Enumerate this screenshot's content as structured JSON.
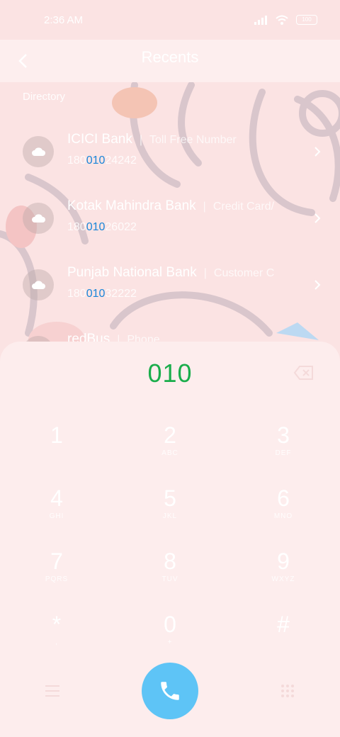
{
  "status": {
    "time": "2:36 AM",
    "battery": "100"
  },
  "header": {
    "title": "Recents"
  },
  "directory": {
    "label": "Directory",
    "items": [
      {
        "name": "ICICI Bank",
        "tag": "Toll Free Number",
        "number_pre": "180",
        "number_match": "010",
        "number_post": "24242"
      },
      {
        "name": "Kotak Mahindra Bank",
        "tag": "Credit Card/",
        "number_pre": "180",
        "number_match": "010",
        "number_post": "26022"
      },
      {
        "name": "Punjab National Bank",
        "tag": "Customer C",
        "number_pre": "180",
        "number_match": "010",
        "number_post": "32222"
      },
      {
        "name": "redBus",
        "tag": "Phone"
      }
    ]
  },
  "dialpad": {
    "input": "010",
    "keys": [
      {
        "digit": "1",
        "letters": ""
      },
      {
        "digit": "2",
        "letters": "ABC"
      },
      {
        "digit": "3",
        "letters": "DEF"
      },
      {
        "digit": "4",
        "letters": "GHI"
      },
      {
        "digit": "5",
        "letters": "JKL"
      },
      {
        "digit": "6",
        "letters": "MNO"
      },
      {
        "digit": "7",
        "letters": "PQRS"
      },
      {
        "digit": "8",
        "letters": "TUV"
      },
      {
        "digit": "9",
        "letters": "WXYZ"
      },
      {
        "digit": "*",
        "letters": ","
      },
      {
        "digit": "0",
        "letters": "+"
      },
      {
        "digit": "#",
        "letters": ""
      }
    ]
  },
  "colors": {
    "accent_green": "#1aad4b",
    "match_blue": "#1a86d9",
    "call_button": "#5ec4f6"
  }
}
